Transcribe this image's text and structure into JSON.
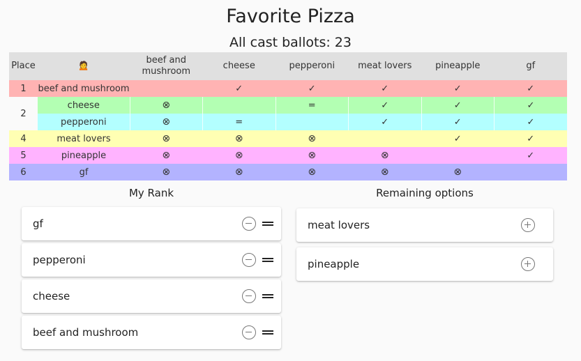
{
  "poll": {
    "title": "Favorite Pizza",
    "ballots_text": "All cast ballots: 23"
  },
  "results": {
    "headers": [
      "Place",
      "🙍",
      "beef and mushroom",
      "cheese",
      "pepperoni",
      "meat lovers",
      "pineapple",
      "gf"
    ],
    "rows": [
      {
        "place": "1",
        "name": "beef and mushroom",
        "color": "#ffb3b3",
        "cells": [
          "",
          "✓",
          "✓",
          "✓",
          "✓",
          "✓"
        ]
      },
      {
        "place": "2",
        "name": "cheese",
        "color": "#b3ffb3",
        "cells": [
          "⊗",
          "",
          "=",
          "✓",
          "✓",
          "✓"
        ]
      },
      {
        "place": "",
        "name": "pepperoni",
        "color": "#b3ffff",
        "cells": [
          "⊗",
          "=",
          "",
          "✓",
          "✓",
          "✓"
        ]
      },
      {
        "place": "4",
        "name": "meat lovers",
        "color": "#ffffb3",
        "cells": [
          "⊗",
          "⊗",
          "⊗",
          "",
          "✓",
          "✓"
        ]
      },
      {
        "place": "5",
        "name": "pineapple",
        "color": "#ffb3ff",
        "cells": [
          "⊗",
          "⊗",
          "⊗",
          "⊗",
          "",
          "✓"
        ]
      },
      {
        "place": "6",
        "name": "gf",
        "color": "#b3b3ff",
        "cells": [
          "⊗",
          "⊗",
          "⊗",
          "⊗",
          "⊗",
          ""
        ]
      }
    ]
  },
  "my_rank": {
    "title": "My Rank",
    "items": [
      "gf",
      "pepperoni",
      "cheese",
      "beef and mushroom"
    ]
  },
  "remaining": {
    "title": "Remaining options",
    "items": [
      "meat lovers",
      "pineapple"
    ]
  },
  "icons": {
    "remove": "minus-circle-icon",
    "drag": "drag-handle-icon",
    "add": "plus-circle-icon",
    "win": "check-icon",
    "lose": "circled-x-icon",
    "tie": "equals-icon"
  }
}
